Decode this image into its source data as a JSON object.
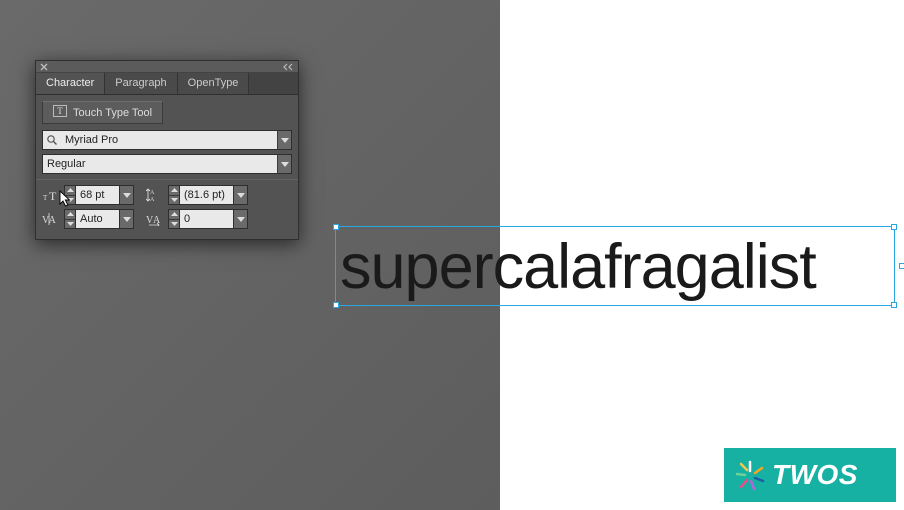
{
  "workspace": {
    "artwork_text": "supercalafragalist"
  },
  "panel": {
    "tabs": {
      "character": "Character",
      "paragraph": "Paragraph",
      "opentype": "OpenType"
    },
    "touch_type_label": "Touch Type Tool",
    "font_family": "Myriad Pro",
    "font_style": "Regular",
    "font_size": "68 pt",
    "leading": "(81.6 pt)",
    "kerning": "Auto",
    "tracking": "0"
  },
  "badge": {
    "text": "TWOS"
  },
  "icons": {
    "close": "close-icon",
    "collapse": "chevrons-left-icon",
    "search": "magnifier-icon",
    "dropdown": "chevron-down-icon",
    "step_up": "triangle-up-icon",
    "step_down": "triangle-down-icon",
    "font_size": "font-size-icon",
    "leading": "leading-icon",
    "kerning": "kerning-icon",
    "tracking": "tracking-icon",
    "touch_type": "touch-type-icon"
  }
}
